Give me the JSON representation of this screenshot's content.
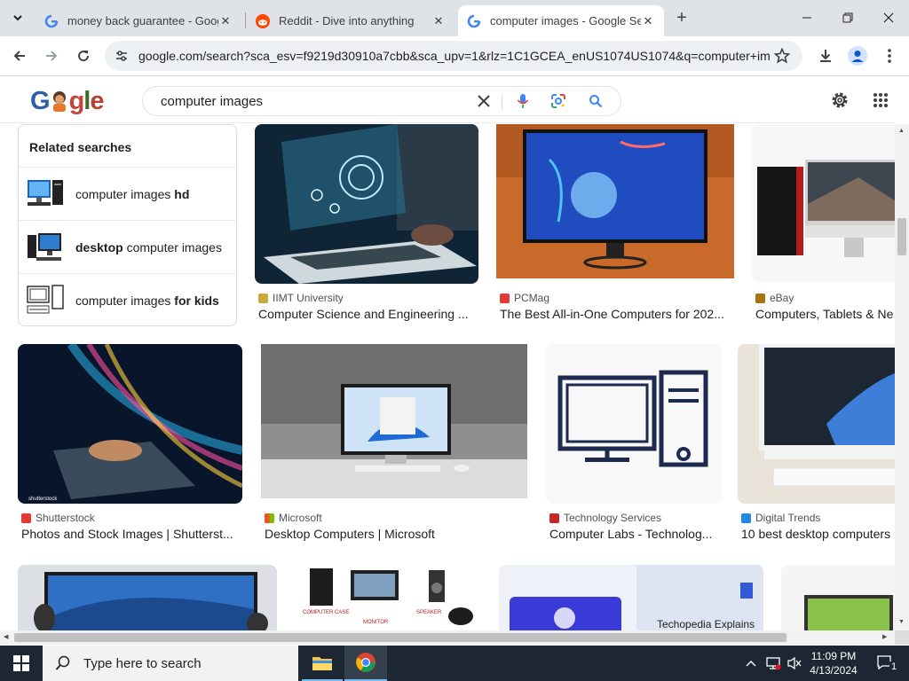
{
  "browser": {
    "tabs": [
      {
        "title": "money back guarantee - Googl",
        "favicon": "google-g-icon"
      },
      {
        "title": "Reddit - Dive into anything",
        "favicon": "reddit-icon"
      },
      {
        "title": "computer images - Google Sea",
        "favicon": "google-g-icon"
      }
    ],
    "tab_close": "✕",
    "new_tab": "+",
    "url": "google.com/search?sca_esv=f9219d30910a7cbb&sca_upv=1&rlz=1C1GCEA_enUS1074US1074&q=computer+im..."
  },
  "google": {
    "query": "computer images"
  },
  "related": {
    "heading": "Related searches",
    "items": [
      {
        "pre": "computer images ",
        "bold": "hd",
        "post": ""
      },
      {
        "pre": "",
        "bold": "desktop",
        "post": " computer images"
      },
      {
        "pre": "computer images ",
        "bold": "for kids",
        "post": ""
      }
    ]
  },
  "results": [
    {
      "source": "IIMT University",
      "caption": "Computer Science and Engineering ...",
      "color": "#c9a93b"
    },
    {
      "source": "PCMag",
      "caption": "The Best All-in-One Computers for 202...",
      "color": "#e53935"
    },
    {
      "source": "eBay",
      "caption": "Computers, Tablets & Ne",
      "color": "#a8740b"
    },
    {
      "source": "Shutterstock",
      "caption": "Photos and Stock Images | Shutterst...",
      "color": "#e53935"
    },
    {
      "source": "Microsoft",
      "caption": "Desktop Computers | Microsoft",
      "color": "#f25022"
    },
    {
      "source": "Technology Services",
      "caption": "Computer Labs - Technolog...",
      "color": "#c62828"
    },
    {
      "source": "Digital Trends",
      "caption": "10 best desktop computers",
      "color": "#1e88e5"
    }
  ],
  "image_labels": {
    "shutterstock": "shutterstock",
    "techopedia": "Techopedia Explains",
    "computer_case": "COMPUTER CASE",
    "monitor": "MONITOR",
    "speaker": "SPEAKER"
  },
  "taskbar": {
    "search_placeholder": "Type here to search",
    "time": "11:09 PM",
    "date": "4/13/2024",
    "notification_count": "1"
  }
}
